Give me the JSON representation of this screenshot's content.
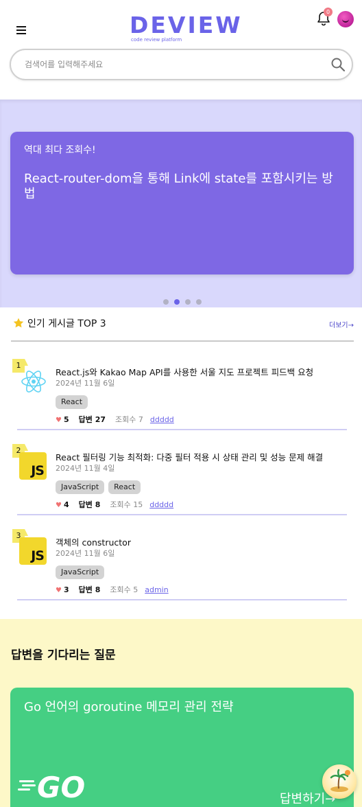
{
  "header": {
    "logo_text": "DEVIEW",
    "logo_tagline": "code review platform",
    "notification_count": "0",
    "search_placeholder": "검색어를 입력해주세요"
  },
  "banner": {
    "label": "역대 최다 조회수!",
    "title": "React-router-dom을 통해 Link에 state를 포함시키는 방법",
    "dot_count": 4,
    "active_dot": 2
  },
  "popular": {
    "title": "인기 게시글 TOP 3",
    "more_label": "더보기→",
    "posts": [
      {
        "rank": "1",
        "icon": "react-icon",
        "title": "React.js와 Kakao Map API를 사용한 서울 지도 프로젝트 피드백 요청",
        "date": "2024년 11월 6일",
        "tags": [
          "React"
        ],
        "likes": "5",
        "answers": "답변 27",
        "views": "조회수 7",
        "author": "ddddd"
      },
      {
        "rank": "2",
        "icon": "javascript-icon",
        "title": "React 필터링 기능 최적화: 다중 필터 적용 시 상태 관리 및 성능 문제 해결",
        "date": "2024년 11월 4일",
        "tags": [
          "JavaScript",
          "React"
        ],
        "likes": "4",
        "answers": "답변 8",
        "views": "조회수 15",
        "author": "ddddd"
      },
      {
        "rank": "3",
        "icon": "javascript-icon",
        "title": "객체의 constructor",
        "date": "2024년 11월 6일",
        "tags": [
          "JavaScript"
        ],
        "likes": "3",
        "answers": "답변 8",
        "views": "조회수 5",
        "author": "admin"
      }
    ],
    "js_logo_text": "JS"
  },
  "waiting": {
    "title": "답변을 기다리는 질문",
    "card_title": "Go 언어의 goroutine 메모리 관리 전략",
    "card_logo": "GO",
    "answer_label": "답변하기→"
  },
  "colors": {
    "brand": "#6a63e8",
    "banner_bg": "#d9d8fc",
    "banner_card": "#7e68e4",
    "waiting_bg": "#fdf8c8",
    "go_card": "#45cf83",
    "rank_badge": "#f5e96a"
  }
}
